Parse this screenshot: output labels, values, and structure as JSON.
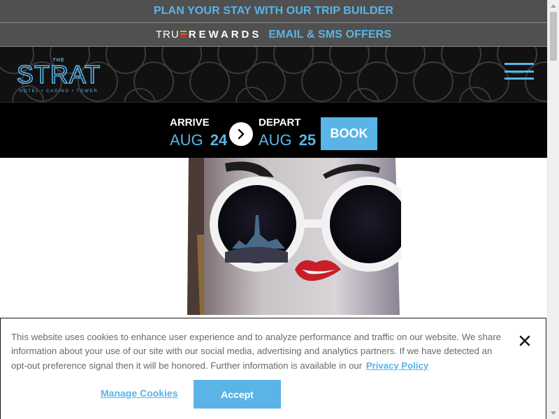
{
  "promo": {
    "trip_builder": "PLAN YOUR STAY WITH OUR TRIP BUILDER",
    "true_prefix": "TRU",
    "rewards_word": "REWARDS",
    "offers": "EMAIL & SMS OFFERS"
  },
  "header": {
    "logo_alt": "THE STRAT HOTEL • CASINO • TOWER",
    "logo_the": "THE",
    "logo_main": "STRAT",
    "logo_sub": "HOTEL • CASINO • TOWER",
    "menu_icon": "hamburger-icon"
  },
  "booking": {
    "arrive_label": "ARRIVE",
    "arrive_month": "AUG",
    "arrive_day": "24",
    "depart_label": "DEPART",
    "depart_month": "AUG",
    "depart_day": "25",
    "book_label": "BOOK",
    "arrow_icon": "chevron-right-icon"
  },
  "cookie": {
    "text": "This website uses cookies to enhance user experience and to analyze performance and traffic on our website. We share information about your use of our site with our social media, advertising and analytics partners. If we have detected an opt-out preference signal then it will be honored. Further information is available in our",
    "privacy_link": "Privacy Policy",
    "manage_label": "Manage Cookies",
    "accept_label": "Accept",
    "close_icon": "close-icon"
  },
  "colors": {
    "accent": "#5ab4e6",
    "promo_bar": "#505050",
    "header_bg": "#111111",
    "booking_bg": "#000000"
  }
}
